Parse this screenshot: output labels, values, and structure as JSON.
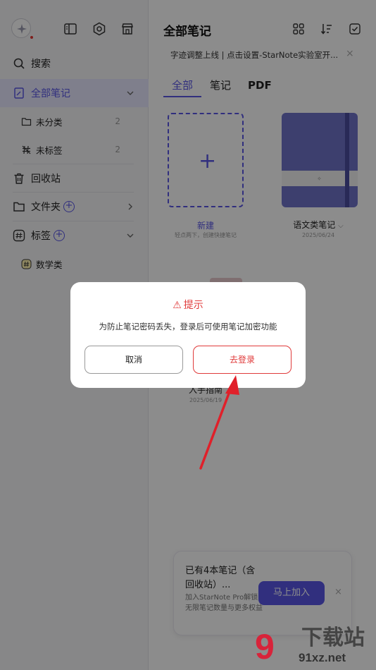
{
  "sidebar": {
    "search": "搜索",
    "all_notes": "全部笔记",
    "uncategorized": {
      "label": "未分类",
      "count": "2"
    },
    "untagged": {
      "label": "未标签",
      "count": "2"
    },
    "recycle": "回收站",
    "folders": "文件夹",
    "tags": "标签",
    "tag_item": "数学类"
  },
  "main": {
    "title": "全部笔记",
    "banner": "字迹调整上线 | 点击设置-StarNote实验室开...",
    "banner_close": "×",
    "tabs": [
      "全部",
      "笔记",
      "PDF"
    ],
    "new_card": {
      "plus": "+",
      "label": "新建",
      "hint": "轻点两下，创建快捷笔记"
    },
    "notebook": {
      "title": "语文类笔记",
      "date": "2025/06/24",
      "mark": "✧"
    },
    "hidden_card": {
      "title": "入手指南",
      "date": "2025/06/19"
    },
    "promo": {
      "title": "已有4本笔记（含回收站）...",
      "desc": "加入StarNote Pro解锁无限笔记数量与更多权益",
      "button": "马上加入",
      "close": "×"
    }
  },
  "dialog": {
    "title": "提示",
    "message": "为防止笔记密码丢失，登录后可使用笔记加密功能",
    "cancel": "取消",
    "login": "去登录"
  },
  "watermark": {
    "brand": "下载站",
    "domain": "91xz.net",
    "logo": "9"
  },
  "colors": {
    "accent": "#5a57e6",
    "danger": "#e03a3a",
    "notebook": "#6f73c9"
  }
}
